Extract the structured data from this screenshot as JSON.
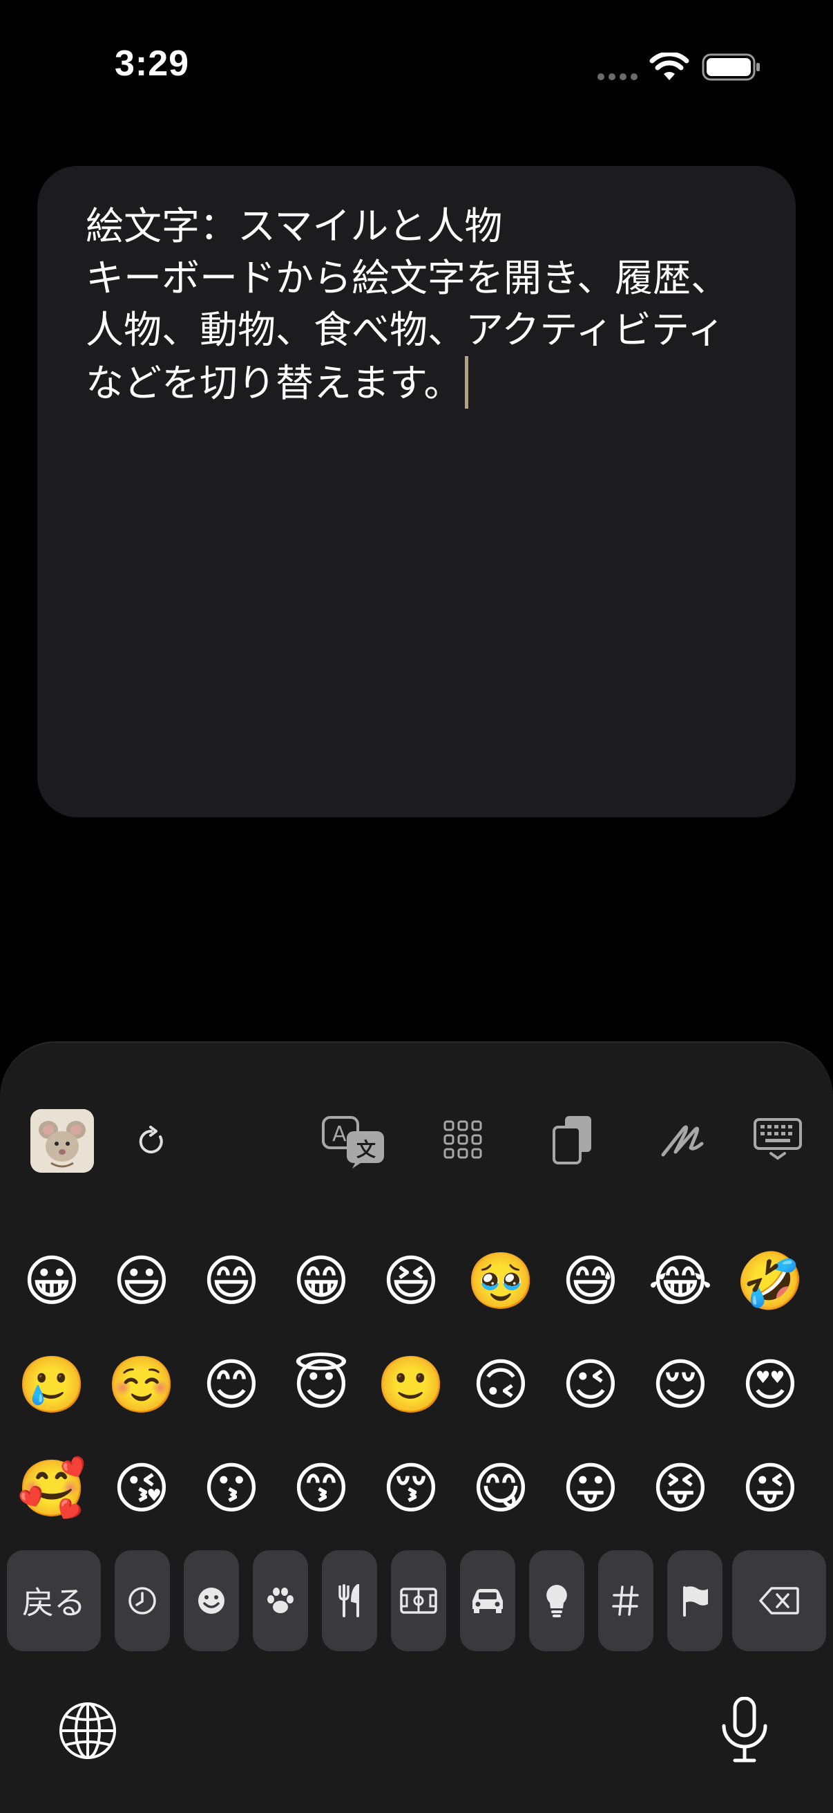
{
  "status_bar": {
    "time": "3:29",
    "icons": [
      "signal-dots-icon",
      "wifi-icon",
      "battery-icon"
    ]
  },
  "note": {
    "text": "絵文字：スマイルと人物\nキーボードから絵文字を開き、履歴、人物、動物、食べ物、アクティビティなどを切り替えます。"
  },
  "keyboard": {
    "toolbar": [
      "memoji-sticker-icon",
      "refresh-icon",
      "translate-icon",
      "apps-grid-icon",
      "clipboard-icon",
      "handwriting-icon",
      "keyboard-dismiss-icon"
    ],
    "emoji_rows": [
      [
        "😀",
        "😃",
        "😄",
        "😁",
        "😆",
        "🥹",
        "😅",
        "😂",
        "🤣"
      ],
      [
        "🥲",
        "☺️",
        "😊",
        "😇",
        "🙂",
        "🙃",
        "😉",
        "😌",
        "😍"
      ],
      [
        "🥰",
        "😘",
        "😗",
        "😙",
        "😚",
        "😋",
        "😛",
        "😝",
        "😜"
      ]
    ],
    "categories": {
      "back_label": "戻る",
      "icons": [
        "recent-clock-icon",
        "smiley-icon",
        "paw-icon",
        "food-utensils-icon",
        "activity-field-icon",
        "car-icon",
        "lightbulb-icon",
        "symbols-hash-icon",
        "flag-icon",
        "delete-backspace-icon"
      ]
    },
    "bottom": [
      "globe-icon",
      "microphone-icon"
    ],
    "colors": {
      "key_bg": "#3a3a3c",
      "panel_bg": "#1b1b1b",
      "card_bg": "#1c1c1e",
      "caret": "#b5a37e"
    }
  }
}
